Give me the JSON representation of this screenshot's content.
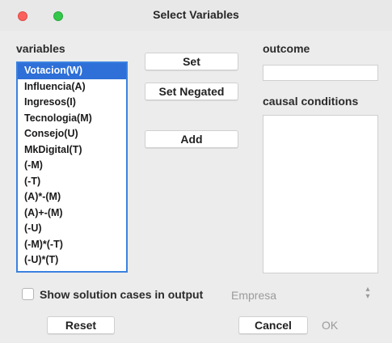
{
  "window": {
    "title": "Select Variables"
  },
  "variables": {
    "label": "variables",
    "items": [
      "Votacion(W)",
      "Influencia(A)",
      "Ingresos(I)",
      "Tecnologia(M)",
      "Consejo(U)",
      "MkDigital(T)",
      "(-M)",
      "(-T)",
      "(A)*-(M)",
      "(A)+-(M)",
      "(-U)",
      "(-M)*(-T)",
      "(-U)*(T)"
    ],
    "selected_index": 0
  },
  "buttons": {
    "set": "Set",
    "set_negated": "Set Negated",
    "add": "Add",
    "reset": "Reset",
    "cancel": "Cancel",
    "ok": "OK"
  },
  "outcome": {
    "label": "outcome",
    "value": ""
  },
  "causal_conditions": {
    "label": "causal conditions",
    "items": []
  },
  "options": {
    "show_solution_cases_label": "Show solution cases in output",
    "show_solution_cases_checked": false,
    "case_id_value": "Empresa"
  },
  "icons": {
    "close": "close-icon",
    "zoom": "zoom-icon",
    "stepper": "up-down-stepper-icon"
  },
  "colors": {
    "selection": "#2e6fd8",
    "focus_ring": "#3b82e0",
    "close_button": "#fc605c",
    "zoom_button": "#34c84a"
  }
}
